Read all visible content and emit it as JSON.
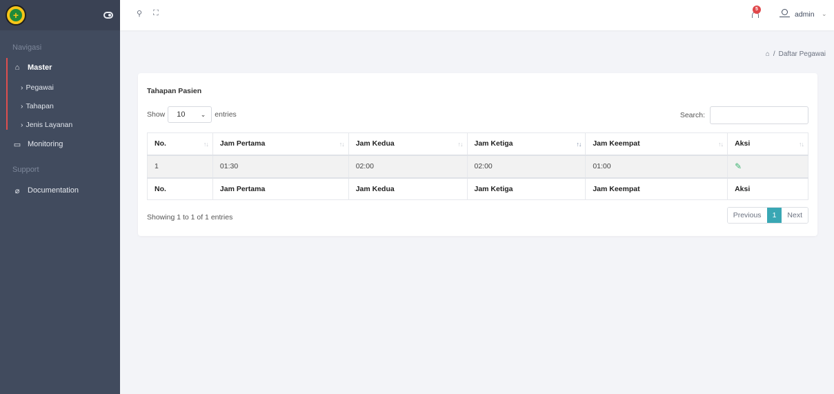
{
  "sidebar": {
    "sections": [
      "Navigasi",
      "Support"
    ],
    "master": "Master",
    "sub_items": [
      "Pegawai",
      "Tahapan",
      "Jenis Layanan"
    ],
    "monitoring": "Monitoring",
    "documentation": "Documentation",
    "active_color": "#e04e4e",
    "bg_color": "#414b5e"
  },
  "topbar": {
    "notification_count": "5",
    "user": "admin"
  },
  "breadcrumb": {
    "separator": "/",
    "current": "Daftar Pegawai"
  },
  "card": {
    "title": "Tahapan Pasien",
    "show_label": "Show",
    "entries_value": "10",
    "entries_label": "entries",
    "search_label": "Search:"
  },
  "table": {
    "columns": [
      "No.",
      "Jam Pertama",
      "Jam Kedua",
      "Jam Ketiga",
      "Jam Keempat",
      "Aksi"
    ],
    "rows": [
      [
        "1",
        "01:30",
        "02:00",
        "02:00",
        "01:00"
      ]
    ]
  },
  "footer": {
    "info": "Showing 1 to 1 of 1 entries",
    "previous": "Previous",
    "page": "1",
    "next": "Next",
    "accent_color": "#39a7b4"
  }
}
